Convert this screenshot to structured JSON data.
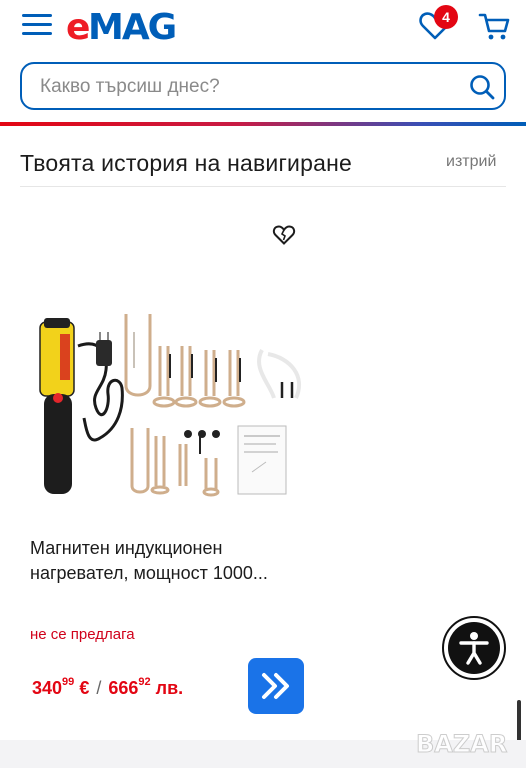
{
  "header": {
    "logo_text": "eMAG",
    "favorites_count": "4"
  },
  "search": {
    "placeholder": "Какво търсиш днес?"
  },
  "history": {
    "title": "Твоята история на навигиране",
    "delete_label": "изтрий"
  },
  "product": {
    "title_line1": "Магнитен индукционен",
    "title_line2": "нагревател, мощност 1000...",
    "availability": "не се предлага",
    "price_eur_int": "340",
    "price_eur_dec": "99",
    "price_eur_cur": "€",
    "price_bgn_int": "666",
    "price_bgn_dec": "92",
    "price_bgn_cur": "лв."
  },
  "watermark": {
    "text": "BAZAR"
  },
  "icons": {
    "menu": "hamburger-icon",
    "favorites": "heart-icon",
    "cart": "cart-icon",
    "search": "search-icon",
    "wishlist": "heart-outline-icon",
    "go": "double-chevron-right-icon",
    "accessibility": "accessibility-person-icon"
  },
  "colors": {
    "brand_blue": "#005eb8",
    "brand_red": "#e30613",
    "button_blue": "#1a73e8"
  }
}
